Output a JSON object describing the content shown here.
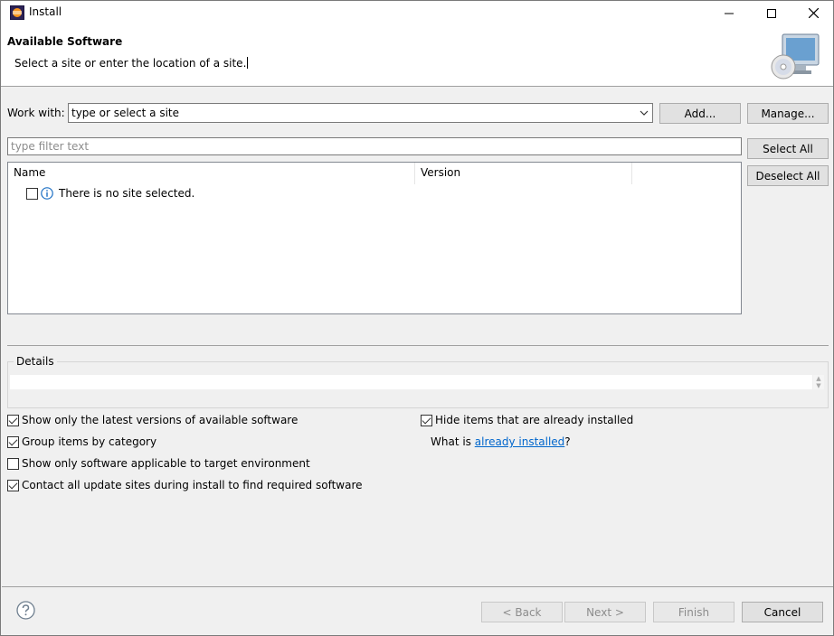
{
  "window": {
    "title": "Install"
  },
  "banner": {
    "title": "Available Software",
    "message": "Select a site or enter the location of a site."
  },
  "work_with": {
    "label": "Work with:",
    "value": "type or select a site",
    "add_label": "Add...",
    "manage_label": "Manage..."
  },
  "filter": {
    "placeholder": "type filter text",
    "select_all_label": "Select All",
    "deselect_all_label": "Deselect All"
  },
  "tree": {
    "columns": [
      "Name",
      "Version"
    ],
    "rows": [
      {
        "text": "There is no site selected.",
        "checked": false,
        "icon": "info-icon"
      }
    ]
  },
  "details": {
    "label": "Details"
  },
  "options": {
    "latest_versions": {
      "label": "Show only the latest versions of available software",
      "checked": true
    },
    "group_by_category": {
      "label": "Group items by category",
      "checked": true
    },
    "applicable_target": {
      "label": "Show only software applicable to target environment",
      "checked": false
    },
    "contact_sites": {
      "label": "Contact all update sites during install to find required software",
      "checked": true
    },
    "hide_installed": {
      "label": "Hide items that are already installed",
      "checked": true
    },
    "what_is_prefix": "What is ",
    "what_is_link": "already installed",
    "what_is_suffix": "?"
  },
  "footer": {
    "back_label": "< Back",
    "next_label": "Next >",
    "finish_label": "Finish",
    "cancel_label": "Cancel"
  },
  "colors": {
    "link": "#0066cc",
    "disabled_text": "#8c8c8c",
    "window_bg": "#f0f0f0"
  }
}
